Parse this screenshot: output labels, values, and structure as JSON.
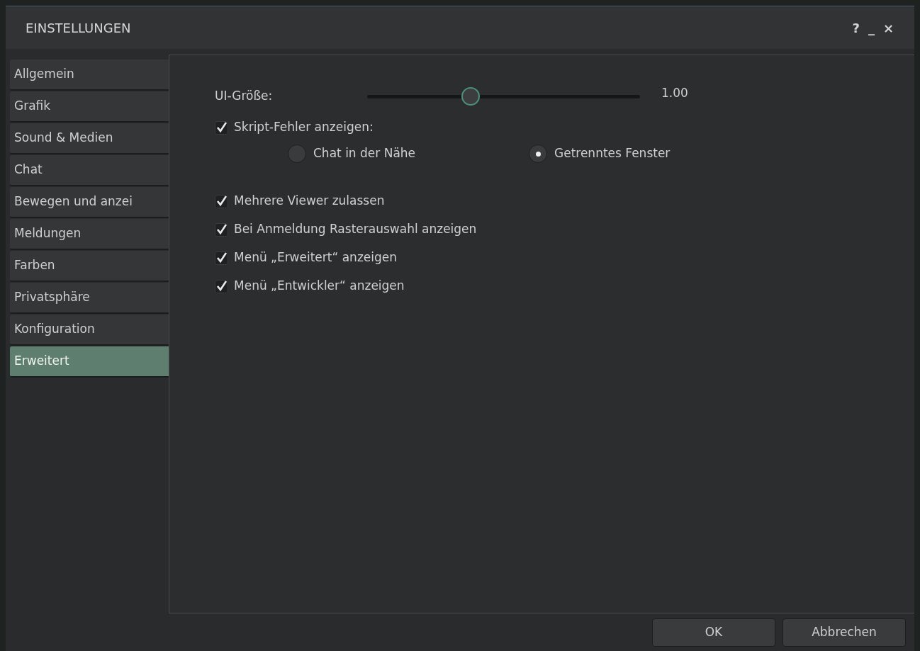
{
  "window": {
    "title": "EINSTELLUNGEN",
    "controls": [
      "?",
      "_",
      "×"
    ]
  },
  "sidebar": {
    "items": [
      {
        "label": "Allgemein",
        "selected": false
      },
      {
        "label": "Grafik",
        "selected": false
      },
      {
        "label": "Sound & Medien",
        "selected": false
      },
      {
        "label": "Chat",
        "selected": false
      },
      {
        "label": "Bewegen und anzei",
        "selected": false
      },
      {
        "label": "Meldungen",
        "selected": false
      },
      {
        "label": "Farben",
        "selected": false
      },
      {
        "label": "Privatsphäre",
        "selected": false
      },
      {
        "label": "Konfiguration",
        "selected": false
      },
      {
        "label": "Erweitert",
        "selected": true
      }
    ]
  },
  "ui_size": {
    "label": "UI-Größe:",
    "level": 0.38,
    "reading": "1.00"
  },
  "script_errors": {
    "label": "Skript-Fehler anzeigen:",
    "checked": true,
    "options": [
      {
        "label": "Chat in der Nähe",
        "selected": false
      },
      {
        "label": "Getrenntes Fenster",
        "selected": true
      }
    ]
  },
  "options": [
    {
      "label": "Mehrere Viewer zulassen",
      "checked": true
    },
    {
      "label": "Bei Anmeldung Rasterauswahl anzeigen",
      "checked": true
    },
    {
      "label": "Menü „Erweitert“ anzeigen",
      "checked": true
    },
    {
      "label": "Menü „Entwickler“ anzeigen",
      "checked": true
    }
  ],
  "buttons": [
    "OK",
    "Abbrechen"
  ]
}
